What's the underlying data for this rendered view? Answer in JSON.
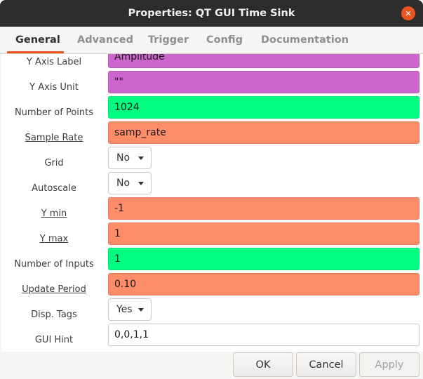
{
  "window": {
    "title": "Properties: QT GUI Time Sink",
    "close_glyph": "✕"
  },
  "tabs": [
    {
      "label": "General",
      "active": true
    },
    {
      "label": "Advanced",
      "active": false
    },
    {
      "label": "Trigger",
      "active": false
    },
    {
      "label": "Config",
      "active": false
    },
    {
      "label": "Documentation",
      "active": false
    }
  ],
  "colors": {
    "string_type": "#cc66cc",
    "int_type": "#00ff80",
    "float_type": "#ff8c69",
    "accent": "#e95420"
  },
  "properties": [
    {
      "label": "Y Axis Label",
      "value": "Amplitude",
      "type": "string"
    },
    {
      "label": "Y Axis Unit",
      "value": "\"\"",
      "type": "string"
    },
    {
      "label": "Number of Points",
      "value": "1024",
      "type": "int"
    },
    {
      "label": "Sample Rate",
      "value": "samp_rate",
      "type": "float",
      "underlined": true
    },
    {
      "label": "Grid",
      "value": "No",
      "type": "enum"
    },
    {
      "label": "Autoscale",
      "value": "No",
      "type": "enum"
    },
    {
      "label": "Y min",
      "value": "-1",
      "type": "float",
      "underlined": true
    },
    {
      "label": "Y max",
      "value": "1",
      "type": "float",
      "underlined": true
    },
    {
      "label": "Number of Inputs",
      "value": "1",
      "type": "int"
    },
    {
      "label": "Update Period",
      "value": "0.10",
      "type": "float",
      "underlined": true
    },
    {
      "label": "Disp. Tags",
      "value": "Yes",
      "type": "enum"
    },
    {
      "label": "GUI Hint",
      "value": "0,0,1,1",
      "type": "gui_hint"
    }
  ],
  "buttons": {
    "ok": "OK",
    "cancel": "Cancel",
    "apply": "Apply"
  }
}
